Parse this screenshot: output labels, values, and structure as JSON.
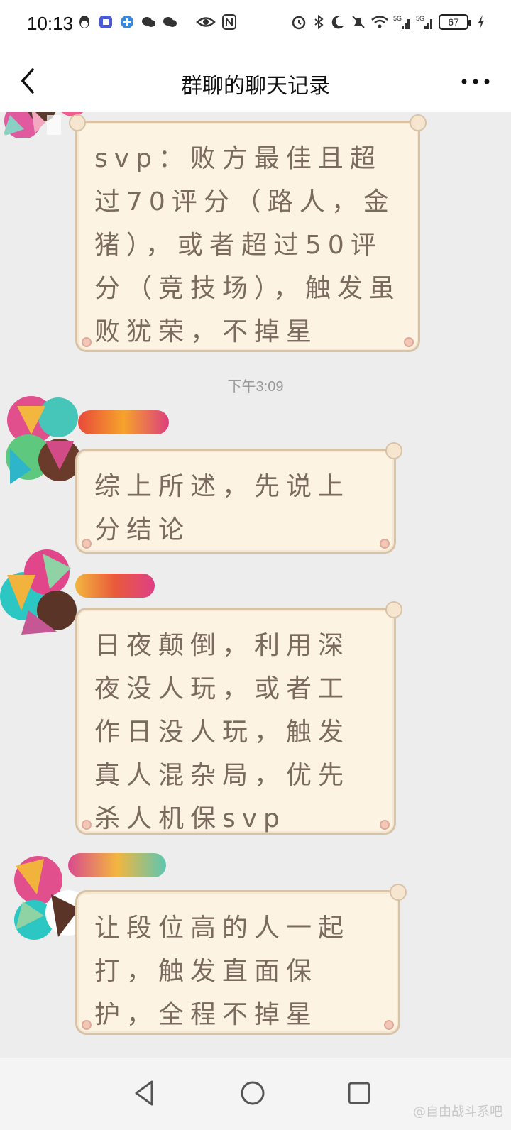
{
  "status_bar": {
    "time": "10:13",
    "battery": "67",
    "network_label": "5G"
  },
  "header": {
    "title": "群聊的聊天记录"
  },
  "messages": [
    {
      "text": "svp：败方最佳且超过70评分（路人，金猪），或者超过50评分（竞技场），触发虽败犹荣，不掉星"
    },
    {
      "text": "综上所述，先说上分结论"
    },
    {
      "text": "日夜颠倒，利用深夜没人玩，或者工作日没人玩，触发真人混杂局，优先杀人机保svp"
    },
    {
      "text": "让段位高的人一起打，触发直面保护，全程不掉星"
    }
  ],
  "timestamp": "下午3:09",
  "watermark": "@自由战斗系吧",
  "colors": {
    "bubble_bg": "#fcf3e2",
    "bubble_border": "#d9c3a7",
    "bubble_text": "#7b6b5e",
    "chat_bg": "#ededed"
  },
  "icons": {
    "back": "chevron-left-icon",
    "more": "more-dots-icon",
    "nav_back": "triangle-back-icon",
    "nav_home": "circle-home-icon",
    "nav_recent": "square-recent-icon"
  }
}
